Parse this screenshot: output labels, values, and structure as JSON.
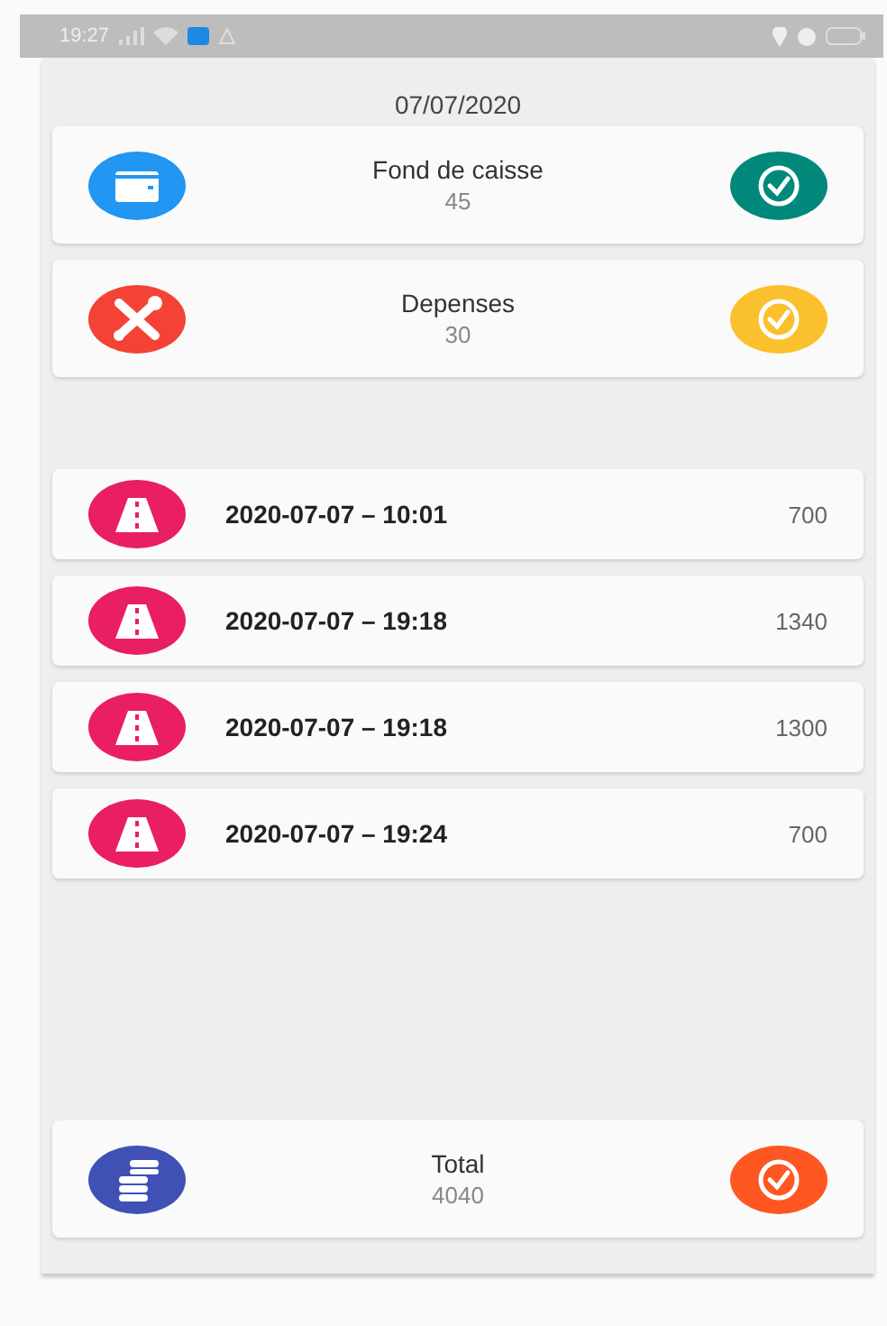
{
  "status_bar": {
    "time": "19:27"
  },
  "date": "07/07/2020",
  "summary": [
    {
      "icon": {
        "kind": "wallet",
        "color": "#2196f3"
      },
      "title": "Fond de caisse",
      "value": "45",
      "check": {
        "color": "#00897b"
      }
    },
    {
      "icon": {
        "kind": "tools",
        "color": "#f44336"
      },
      "title": "Depenses",
      "value": "30",
      "check": {
        "color": "#fbc02d"
      }
    }
  ],
  "entries": [
    {
      "datetime": "2020-07-07 – 10:01",
      "amount": "700"
    },
    {
      "datetime": "2020-07-07 – 19:18",
      "amount": "1340"
    },
    {
      "datetime": "2020-07-07 – 19:18",
      "amount": "1300"
    },
    {
      "datetime": "2020-07-07 – 19:24",
      "amount": "700"
    }
  ],
  "total": {
    "icon": {
      "kind": "coins",
      "color": "#3f51b5"
    },
    "title": "Total",
    "value": "4040",
    "check": {
      "color": "#ff5722"
    }
  }
}
